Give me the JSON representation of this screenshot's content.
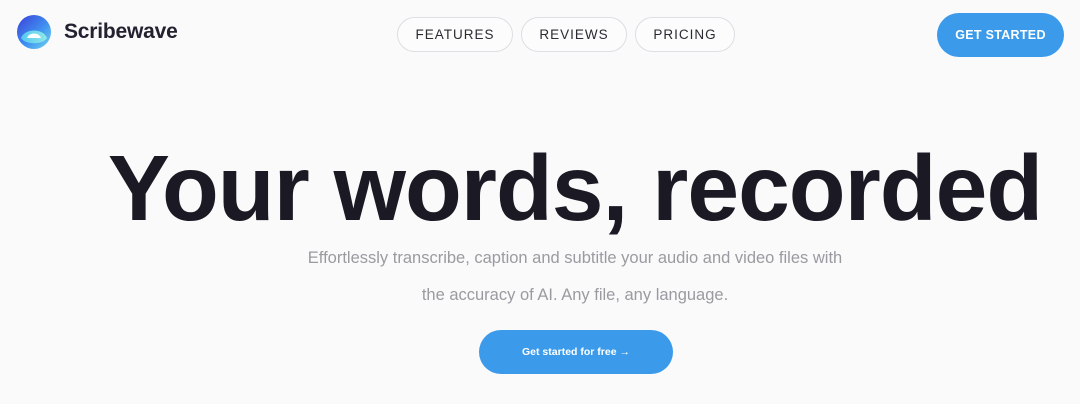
{
  "brand": {
    "name": "Scribewave",
    "logo_icon": "scribewave-logo-icon",
    "logo_colors": [
      "#3b5fe0",
      "#4fb6f0",
      "#7fe0e8"
    ]
  },
  "nav": {
    "items": [
      {
        "label": "FEATURES"
      },
      {
        "label": "REVIEWS"
      },
      {
        "label": "PRICING"
      }
    ]
  },
  "header_cta": {
    "label": "GET STARTED"
  },
  "hero": {
    "title": "Your words, recorded",
    "subtitle_line1": "Effortlessly transcribe, caption and subtitle your audio and video files with",
    "subtitle_line2": "the accuracy of AI. Any file, any language.",
    "cta_label": "Get started for free →"
  },
  "colors": {
    "accent": "#3b9bea",
    "background": "#fafafb",
    "heading": "#1b1a24",
    "muted_text": "#9a9aa0"
  }
}
